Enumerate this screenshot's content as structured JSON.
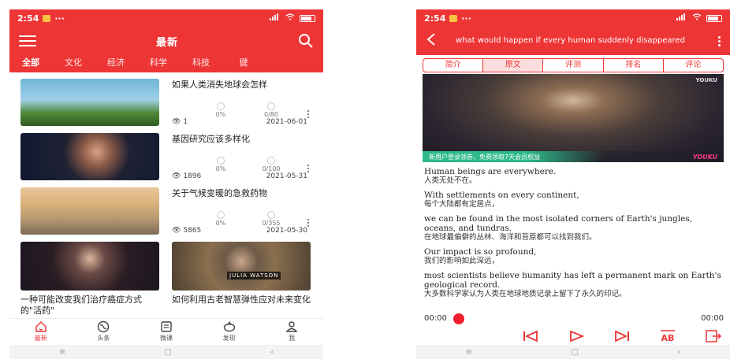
{
  "left": {
    "status": {
      "time": "2:54",
      "dots": "···",
      "signal": "ᴸᵀᴱ",
      "battery": ""
    },
    "header": {
      "title": "最新"
    },
    "categories": [
      "全部",
      "文化",
      "经济",
      "科学",
      "科技",
      "健"
    ],
    "rows": [
      {
        "title": "如果人类消失地球会怎样",
        "pct": "0%",
        "frac": "0/80",
        "views": "1",
        "date": "2021-06-01"
      },
      {
        "title": "基因研究应该多样化",
        "pct": "0%",
        "frac": "0/100",
        "views": "1896",
        "date": "2021-05-31"
      },
      {
        "title": "关于气候变暖的急救药物",
        "pct": "0%",
        "frac": "0/355",
        "views": "5865",
        "date": "2021-05-30"
      }
    ],
    "grid": [
      {
        "title": "一种可能改变我们治疗癌症方式的\"活药\""
      },
      {
        "title": "如何利用古老智慧弹性应对未来变化",
        "watermark": "JULIA WATSON"
      }
    ],
    "nav": [
      {
        "label": "最新"
      },
      {
        "label": "头条"
      },
      {
        "label": "微课"
      },
      {
        "label": "发现"
      },
      {
        "label": "我"
      }
    ],
    "accent": "#ee3536"
  },
  "right": {
    "status": {
      "time": "2:54",
      "dots": "···"
    },
    "header": {
      "title": "what would happen if every human suddenly disappeared"
    },
    "tabs": [
      "简介",
      "原文",
      "评测",
      "排名",
      "评论"
    ],
    "video": {
      "brand": "YOUKU",
      "promo": "新用户登录领券，免费领取7天会员权益",
      "promo_brand": "YOUKU"
    },
    "transcript": [
      {
        "en": "Human beings are everywhere.",
        "zh": "人类无处不在。"
      },
      {
        "en": "With settlements on every continent,",
        "zh": "每个大陆都有定居点，"
      },
      {
        "en": "we can be found in the most isolated corners of Earth's jungles, oceans, and tundras.",
        "zh": "在地球最偏僻的丛林、海洋和苔原都可以找到我们。"
      },
      {
        "en": "Our impact is so profound,",
        "zh": "我们的影响如此深远，"
      },
      {
        "en": "most scientists believe humanity has left a permanent mark on Earth's geological record.",
        "zh": "大多数科学家认为人类在地球地质记录上留下了永久的印记。"
      }
    ],
    "player": {
      "current": "00:00",
      "total": "00:00",
      "progress": 0
    }
  }
}
